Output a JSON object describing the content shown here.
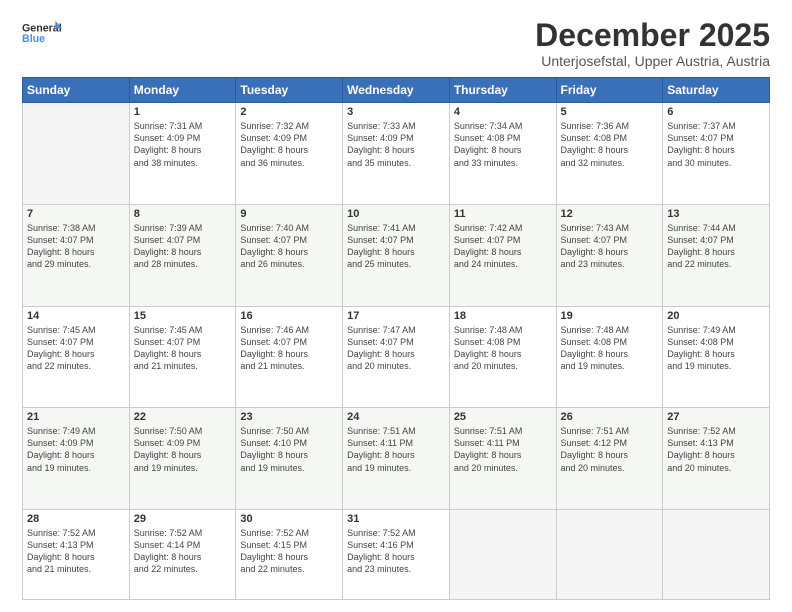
{
  "logo": {
    "line1": "General",
    "line2": "Blue"
  },
  "title": "December 2025",
  "location": "Unterjosefstal, Upper Austria, Austria",
  "weekdays": [
    "Sunday",
    "Monday",
    "Tuesday",
    "Wednesday",
    "Thursday",
    "Friday",
    "Saturday"
  ],
  "weeks": [
    [
      {
        "day": "",
        "info": ""
      },
      {
        "day": "1",
        "info": "Sunrise: 7:31 AM\nSunset: 4:09 PM\nDaylight: 8 hours\nand 38 minutes."
      },
      {
        "day": "2",
        "info": "Sunrise: 7:32 AM\nSunset: 4:09 PM\nDaylight: 8 hours\nand 36 minutes."
      },
      {
        "day": "3",
        "info": "Sunrise: 7:33 AM\nSunset: 4:09 PM\nDaylight: 8 hours\nand 35 minutes."
      },
      {
        "day": "4",
        "info": "Sunrise: 7:34 AM\nSunset: 4:08 PM\nDaylight: 8 hours\nand 33 minutes."
      },
      {
        "day": "5",
        "info": "Sunrise: 7:36 AM\nSunset: 4:08 PM\nDaylight: 8 hours\nand 32 minutes."
      },
      {
        "day": "6",
        "info": "Sunrise: 7:37 AM\nSunset: 4:07 PM\nDaylight: 8 hours\nand 30 minutes."
      }
    ],
    [
      {
        "day": "7",
        "info": "Sunrise: 7:38 AM\nSunset: 4:07 PM\nDaylight: 8 hours\nand 29 minutes."
      },
      {
        "day": "8",
        "info": "Sunrise: 7:39 AM\nSunset: 4:07 PM\nDaylight: 8 hours\nand 28 minutes."
      },
      {
        "day": "9",
        "info": "Sunrise: 7:40 AM\nSunset: 4:07 PM\nDaylight: 8 hours\nand 26 minutes."
      },
      {
        "day": "10",
        "info": "Sunrise: 7:41 AM\nSunset: 4:07 PM\nDaylight: 8 hours\nand 25 minutes."
      },
      {
        "day": "11",
        "info": "Sunrise: 7:42 AM\nSunset: 4:07 PM\nDaylight: 8 hours\nand 24 minutes."
      },
      {
        "day": "12",
        "info": "Sunrise: 7:43 AM\nSunset: 4:07 PM\nDaylight: 8 hours\nand 23 minutes."
      },
      {
        "day": "13",
        "info": "Sunrise: 7:44 AM\nSunset: 4:07 PM\nDaylight: 8 hours\nand 22 minutes."
      }
    ],
    [
      {
        "day": "14",
        "info": "Sunrise: 7:45 AM\nSunset: 4:07 PM\nDaylight: 8 hours\nand 22 minutes."
      },
      {
        "day": "15",
        "info": "Sunrise: 7:45 AM\nSunset: 4:07 PM\nDaylight: 8 hours\nand 21 minutes."
      },
      {
        "day": "16",
        "info": "Sunrise: 7:46 AM\nSunset: 4:07 PM\nDaylight: 8 hours\nand 21 minutes."
      },
      {
        "day": "17",
        "info": "Sunrise: 7:47 AM\nSunset: 4:07 PM\nDaylight: 8 hours\nand 20 minutes."
      },
      {
        "day": "18",
        "info": "Sunrise: 7:48 AM\nSunset: 4:08 PM\nDaylight: 8 hours\nand 20 minutes."
      },
      {
        "day": "19",
        "info": "Sunrise: 7:48 AM\nSunset: 4:08 PM\nDaylight: 8 hours\nand 19 minutes."
      },
      {
        "day": "20",
        "info": "Sunrise: 7:49 AM\nSunset: 4:08 PM\nDaylight: 8 hours\nand 19 minutes."
      }
    ],
    [
      {
        "day": "21",
        "info": "Sunrise: 7:49 AM\nSunset: 4:09 PM\nDaylight: 8 hours\nand 19 minutes."
      },
      {
        "day": "22",
        "info": "Sunrise: 7:50 AM\nSunset: 4:09 PM\nDaylight: 8 hours\nand 19 minutes."
      },
      {
        "day": "23",
        "info": "Sunrise: 7:50 AM\nSunset: 4:10 PM\nDaylight: 8 hours\nand 19 minutes."
      },
      {
        "day": "24",
        "info": "Sunrise: 7:51 AM\nSunset: 4:11 PM\nDaylight: 8 hours\nand 19 minutes."
      },
      {
        "day": "25",
        "info": "Sunrise: 7:51 AM\nSunset: 4:11 PM\nDaylight: 8 hours\nand 20 minutes."
      },
      {
        "day": "26",
        "info": "Sunrise: 7:51 AM\nSunset: 4:12 PM\nDaylight: 8 hours\nand 20 minutes."
      },
      {
        "day": "27",
        "info": "Sunrise: 7:52 AM\nSunset: 4:13 PM\nDaylight: 8 hours\nand 20 minutes."
      }
    ],
    [
      {
        "day": "28",
        "info": "Sunrise: 7:52 AM\nSunset: 4:13 PM\nDaylight: 8 hours\nand 21 minutes."
      },
      {
        "day": "29",
        "info": "Sunrise: 7:52 AM\nSunset: 4:14 PM\nDaylight: 8 hours\nand 22 minutes."
      },
      {
        "day": "30",
        "info": "Sunrise: 7:52 AM\nSunset: 4:15 PM\nDaylight: 8 hours\nand 22 minutes."
      },
      {
        "day": "31",
        "info": "Sunrise: 7:52 AM\nSunset: 4:16 PM\nDaylight: 8 hours\nand 23 minutes."
      },
      {
        "day": "",
        "info": ""
      },
      {
        "day": "",
        "info": ""
      },
      {
        "day": "",
        "info": ""
      }
    ]
  ]
}
